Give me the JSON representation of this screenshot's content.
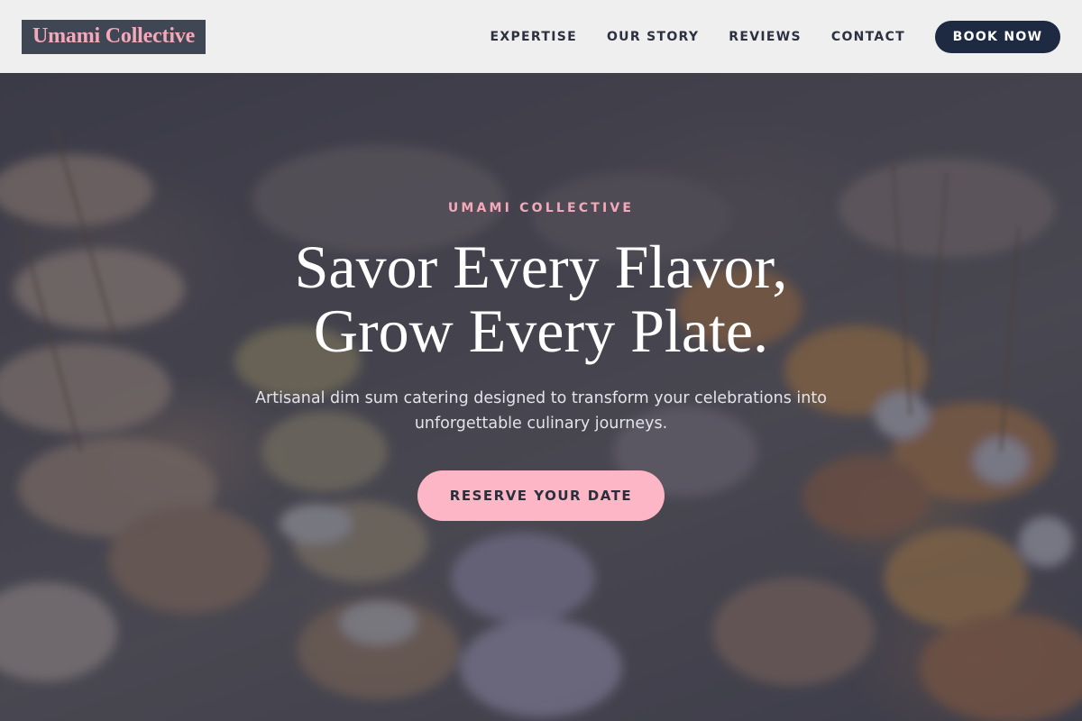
{
  "header": {
    "logo": "Umami Collective",
    "nav": [
      {
        "label": "EXPERTISE"
      },
      {
        "label": "OUR STORY"
      },
      {
        "label": "REVIEWS"
      },
      {
        "label": "CONTACT"
      }
    ],
    "cta": "BOOK NOW"
  },
  "hero": {
    "eyebrow": "UMAMI COLLECTIVE",
    "headline_line1": "Savor Every Flavor,",
    "headline_line2": "Grow Every Plate.",
    "subtitle_line1": "Artisanal dim sum catering designed to transform your celebrations into",
    "subtitle_line2": "unforgettable culinary journeys.",
    "cta": "RESERVE YOUR DATE"
  },
  "colors": {
    "accent_pink": "#fdb6c5",
    "logo_pink": "#f3a9b8",
    "navy": "#1d2a41",
    "logo_bg": "#3f4654"
  }
}
